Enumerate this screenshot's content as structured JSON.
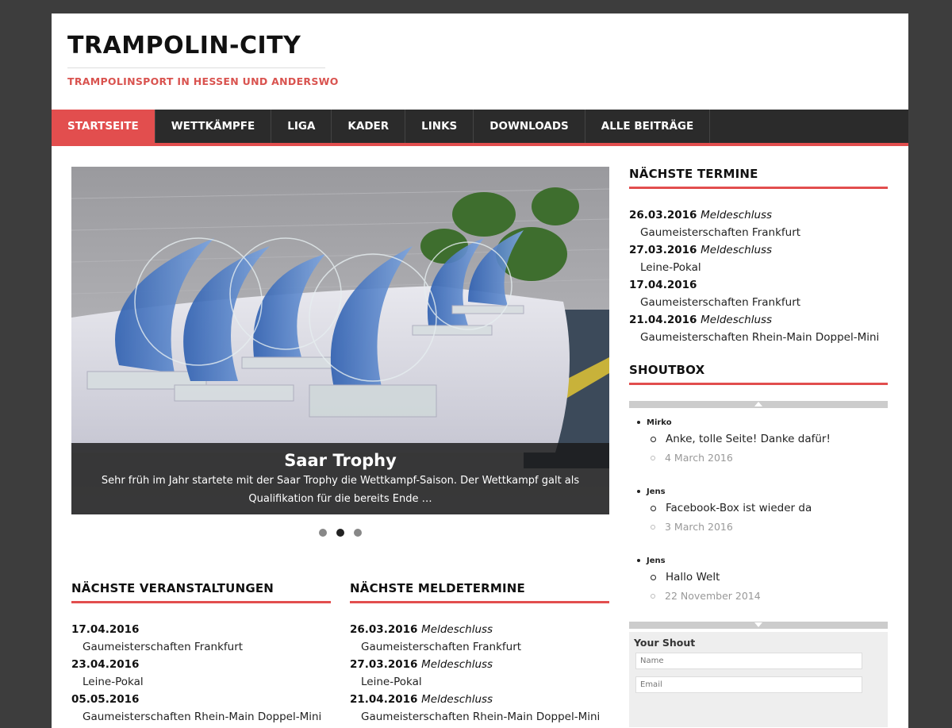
{
  "site": {
    "title": "TRAMPOLIN-CITY",
    "description": "TRAMPOLINSPORT IN HESSEN UND ANDERSWO"
  },
  "nav": [
    {
      "label": "STARTSEITE",
      "active": true
    },
    {
      "label": "WETTKÄMPFE"
    },
    {
      "label": "LIGA"
    },
    {
      "label": "KADER"
    },
    {
      "label": "LINKS"
    },
    {
      "label": "DOWNLOADS"
    },
    {
      "label": "ALLE BEITRÄGE"
    }
  ],
  "slider": {
    "title": "Saar Trophy",
    "text": "Sehr früh im Jahr startete mit der Saar Trophy die Wettkampf-Saison. Der Wettkampf galt als Qualifikation für die bereits Ende …",
    "active_dot": 2,
    "dot_count": 3
  },
  "veranstaltungen": {
    "title": "NÄCHSTE VERANSTALTUNGEN",
    "items": [
      {
        "date": "17.04.2016",
        "name": "Gaumeisterschaften Frankfurt"
      },
      {
        "date": "23.04.2016",
        "name": "Leine-Pokal"
      },
      {
        "date": "05.05.2016",
        "name": "Gaumeisterschaften Rhein-Main Doppel-Mini"
      }
    ]
  },
  "meldetermine": {
    "title": "NÄCHSTE MELDETERMINE",
    "items": [
      {
        "date": "26.03.2016",
        "tag": "Meldeschluss",
        "name": "Gaumeisterschaften Frankfurt"
      },
      {
        "date": "27.03.2016",
        "tag": "Meldeschluss",
        "name": "Leine-Pokal"
      },
      {
        "date": "21.04.2016",
        "tag": "Meldeschluss",
        "name": "Gaumeisterschaften Rhein-Main Doppel-Mini"
      }
    ]
  },
  "termine": {
    "title": "NÄCHSTE TERMINE",
    "items": [
      {
        "date": "26.03.2016",
        "tag": "Meldeschluss",
        "name": "Gaumeisterschaften Frankfurt"
      },
      {
        "date": "27.03.2016",
        "tag": "Meldeschluss",
        "name": "Leine-Pokal"
      },
      {
        "date": "17.04.2016",
        "tag": "",
        "name": "Gaumeisterschaften Frankfurt"
      },
      {
        "date": "21.04.2016",
        "tag": "Meldeschluss",
        "name": "Gaumeisterschaften Rhein-Main Doppel-Mini"
      }
    ]
  },
  "shoutbox": {
    "title": "SHOUTBOX",
    "shouts": [
      {
        "user": "Mirko",
        "message": "Anke, tolle Seite! Danke dafür!",
        "time": "4 March 2016"
      },
      {
        "user": "Jens",
        "message": "Facebook-Box ist wieder da",
        "time": "3 March 2016"
      },
      {
        "user": "Jens",
        "message": "Hallo Welt",
        "time": "22 November 2014"
      }
    ],
    "form_title": "Your Shout",
    "name_placeholder": "Name",
    "email_placeholder": "Email"
  },
  "colors": {
    "accent": "#e24e4e",
    "nav_bg": "#2b2b2b",
    "page_bg": "#3d3d3d"
  }
}
